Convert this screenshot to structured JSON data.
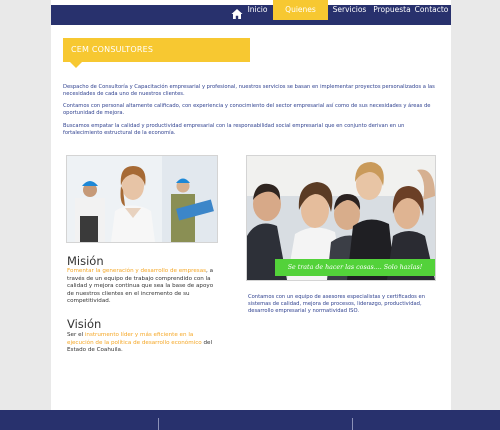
{
  "nav": {
    "items": [
      {
        "label": "Inicio",
        "active": false
      },
      {
        "label": "Quienes somos",
        "active": true
      },
      {
        "label": "Servicios",
        "active": false
      },
      {
        "label": "Propuesta",
        "active": false
      },
      {
        "label": "Contacto",
        "active": false
      }
    ]
  },
  "banner": {
    "title": "CEM CONSULTORES"
  },
  "intro": {
    "p1": "Despacho de  Consultoría y Capacitación empresarial y profesional, nuestros servicios se basan en  implementar proyectos personalizados a las necesidades de cada uno de nuestros clientes.",
    "p2": "Contamos con personal altamente calificado, con experiencia y conocimiento del sector empresarial así como de sus necesidades y áreas de oportunidad de mejora.",
    "p3": "Buscamos empatar la calidad y productividad empresarial con la responsabilidad social  empresarial que en conjunto derivan en un fortalecimiento estructural de la economía."
  },
  "team_photo": {
    "caption": "Se trata de hacer las cosas.... Solo hazlas!"
  },
  "team_description": "Contamos con un equipo de asesores especialistas y certificados en sistemas de calidad, mejora de procesos, liderazgo, productividad, desarrollo empresarial y normatividad ISO.",
  "mision": {
    "heading": "Misión",
    "highlight": "Fomentar la generación y desarrollo de empresas",
    "rest": ", a través de un equipo de trabajo comprendido con la calidad y mejora continua que sea la base de apoyo de nuestros clientes en el incremento de su competitividad."
  },
  "vision": {
    "heading": "Visión",
    "pre": "Ser el ",
    "highlight": "instrumento líder y más eficiente en la ejecución de la política de desarrollo económico",
    "post": " del Estado de Coahuila."
  },
  "colors": {
    "navy": "#28316d",
    "yellow": "#f7c831",
    "orange": "#f5a623",
    "green": "#53d23a",
    "blue_text": "#2d3f8e"
  }
}
